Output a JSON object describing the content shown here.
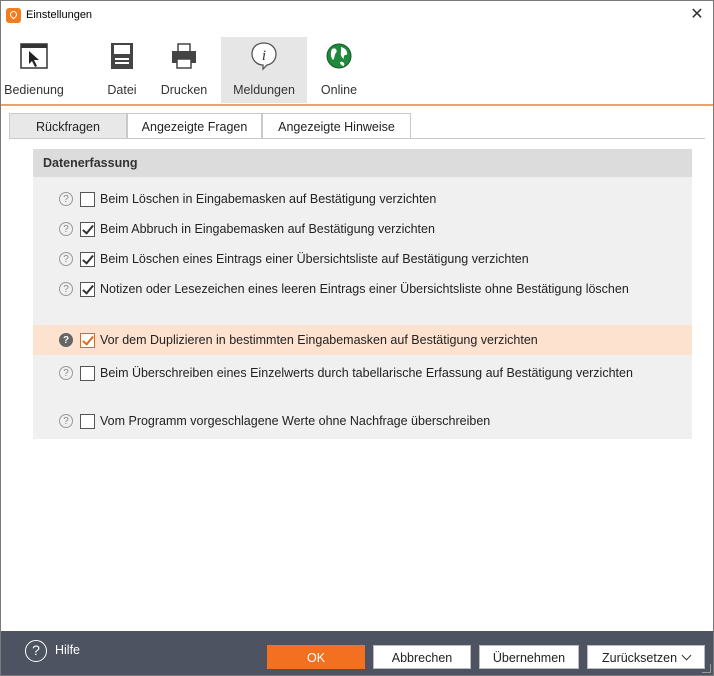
{
  "window": {
    "title": "Einstellungen",
    "close_glyph": "✕"
  },
  "toolbar": {
    "items": [
      {
        "label": "Bedienung",
        "icon": "cursor-window-icon"
      },
      {
        "label": "Datei",
        "icon": "floppy-disk-icon"
      },
      {
        "label": "Drucken",
        "icon": "printer-icon"
      },
      {
        "label": "Meldungen",
        "icon": "info-bubble-icon",
        "active": true
      },
      {
        "label": "Online",
        "icon": "globe-icon"
      }
    ]
  },
  "tabs": [
    {
      "label": "Rückfragen",
      "active": true
    },
    {
      "label": "Angezeigte Fragen",
      "active": false
    },
    {
      "label": "Angezeigte Hinweise",
      "active": false
    }
  ],
  "section": {
    "title": "Datenerfassung",
    "options": [
      {
        "text": "Beim Löschen in Eingabemasken auf Bestätigung verzichten",
        "checked": false
      },
      {
        "text": "Beim Abbruch in Eingabemasken auf Bestätigung verzichten",
        "checked": true
      },
      {
        "text": "Beim Löschen eines Eintrags einer Übersichtsliste auf Bestätigung verzichten",
        "checked": true
      },
      {
        "text": "Notizen oder Lesezeichen eines leeren Eintrags einer Übersichtsliste ohne Bestätigung löschen",
        "checked": true
      },
      {
        "text": "Vor dem Duplizieren in bestimmten Eingabemasken auf Bestätigung verzichten",
        "checked": true,
        "highlighted": true
      },
      {
        "text": "Beim Überschreiben eines Einzelwerts durch tabellarische Erfassung auf Bestätigung verzichten",
        "checked": false
      },
      {
        "text": "Vom Programm vorgeschlagene Werte ohne Nachfrage überschreiben",
        "checked": false
      }
    ]
  },
  "footer": {
    "help_label": "Hilfe",
    "help_glyph": "?",
    "ok_label": "OK",
    "cancel_label": "Abbrechen",
    "apply_label": "Übernehmen",
    "reset_label": "Zurücksetzen"
  },
  "colors": {
    "accent": "#f37021",
    "footer_bg": "#4d5360",
    "highlight_row": "#fde2cf"
  }
}
